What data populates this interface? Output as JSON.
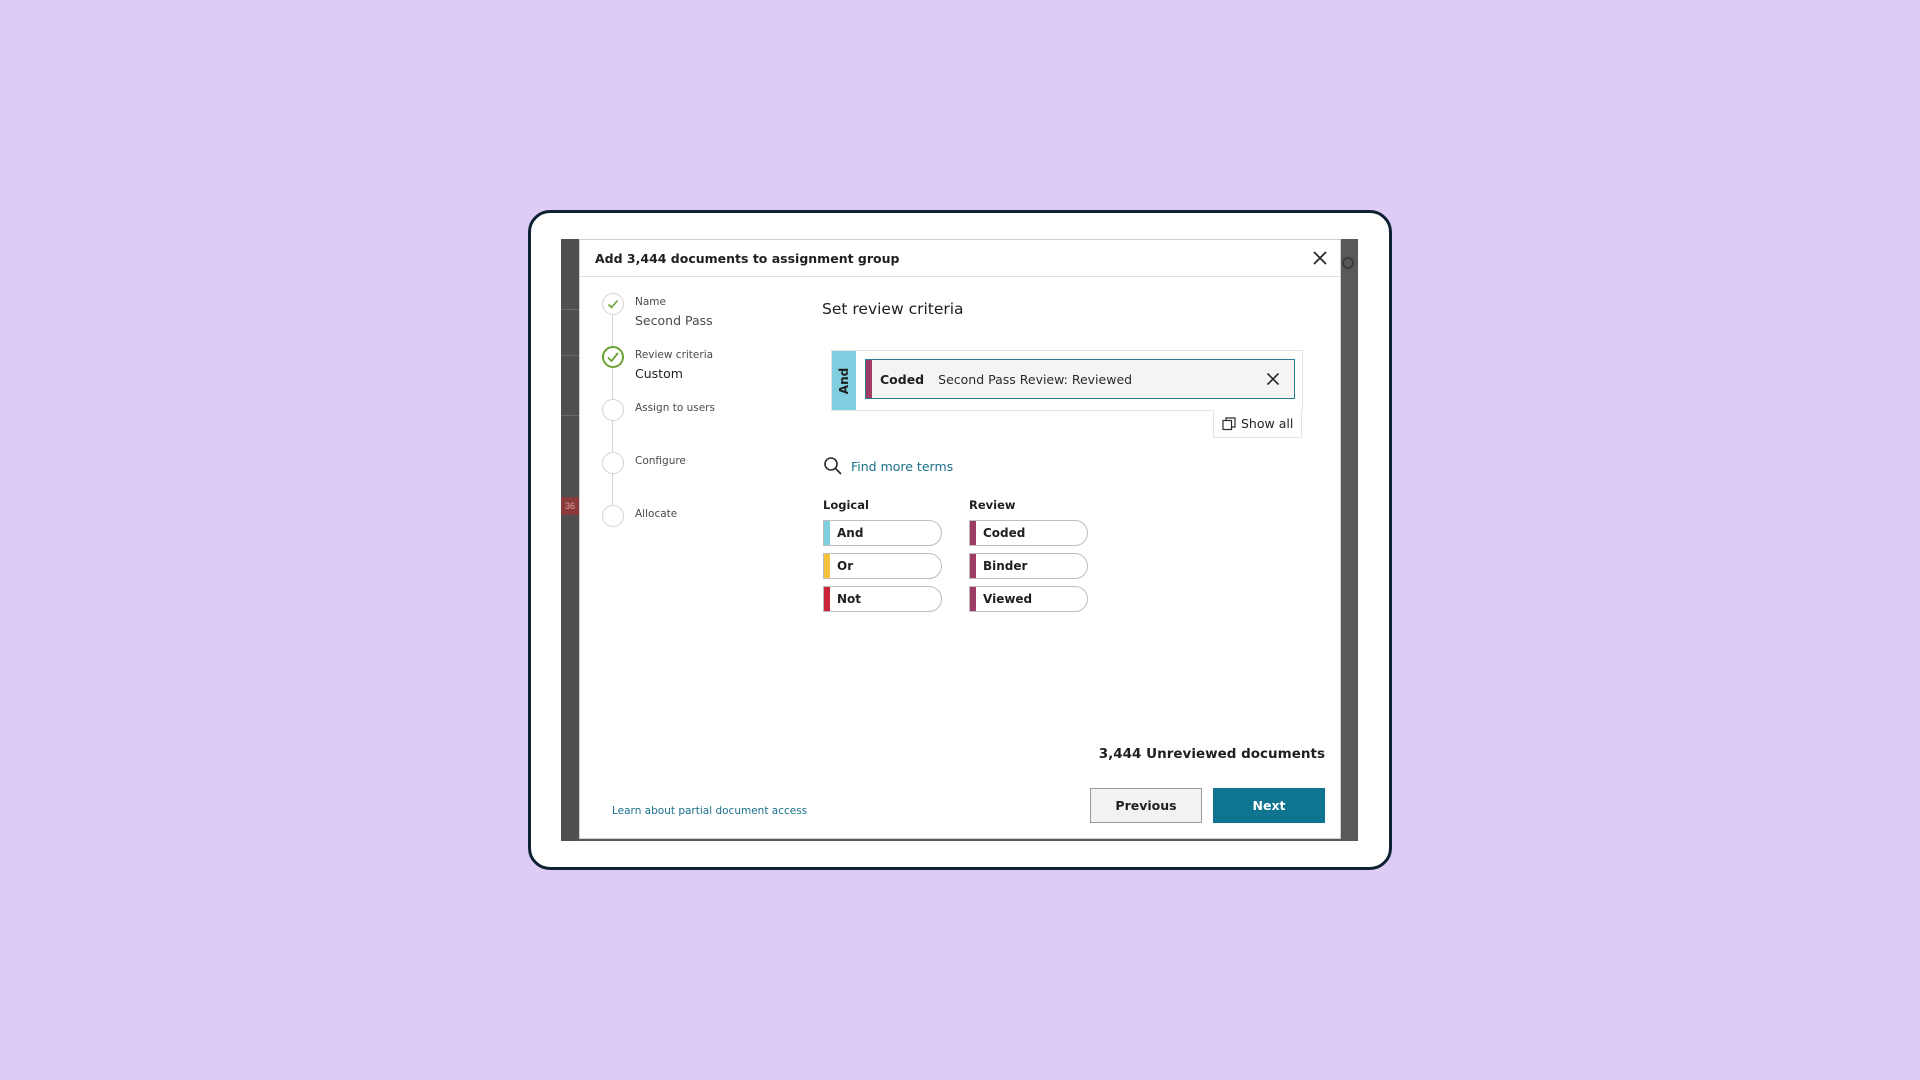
{
  "modal": {
    "title": "Add 3,444 documents to assignment group",
    "close_icon": "close-icon"
  },
  "stepper": {
    "steps": [
      {
        "label": "Name",
        "value": "Second Pass",
        "state": "done"
      },
      {
        "label": "Review criteria",
        "value": "Custom",
        "state": "active"
      },
      {
        "label": "Assign to users",
        "value": "",
        "state": "pending"
      },
      {
        "label": "Configure",
        "value": "",
        "state": "pending"
      },
      {
        "label": "Allocate",
        "value": "",
        "state": "pending"
      }
    ]
  },
  "main": {
    "title": "Set review criteria",
    "criteria": {
      "operator": "And",
      "chip_type": "Coded",
      "chip_description": "Second Pass Review: Reviewed"
    },
    "show_all_label": "Show all",
    "find_terms_label": "Find more terms",
    "logical": {
      "title": "Logical",
      "items": [
        {
          "label": "And",
          "color": "#7fcfe0"
        },
        {
          "label": "Or",
          "color": "#f5c23e"
        },
        {
          "label": "Not",
          "color": "#c8243a"
        }
      ]
    },
    "review": {
      "title": "Review",
      "items": [
        {
          "label": "Coded",
          "color": "#9e3c65"
        },
        {
          "label": "Binder",
          "color": "#9e3c65"
        },
        {
          "label": "Viewed",
          "color": "#9e3c65"
        }
      ]
    },
    "unreviewed_text": "3,444 Unreviewed documents"
  },
  "footer": {
    "link_text": "Learn about partial document access",
    "previous_label": "Previous",
    "next_label": "Next"
  },
  "background": {
    "badge_text": "36"
  },
  "colors": {
    "page_bg": "#ddcdf4",
    "accent": "#0e7490",
    "check_green": "#6aa232"
  }
}
